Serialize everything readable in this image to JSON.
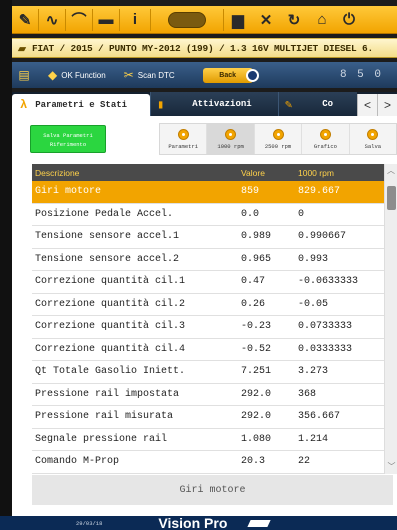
{
  "toolbar": {
    "icons": [
      "wrench-icon",
      "pulse-icon",
      "wifi-icon",
      "folder-icon",
      "info-icon",
      "brand-logo",
      "print-icon",
      "tools-icon",
      "refresh-icon",
      "home-icon",
      "power-icon"
    ],
    "info_label": "i"
  },
  "vehicle_path": "FIAT / 2015 / PUNTO MY-2012 (199) / 1.3 16V MULTIJET DIESEL 6.",
  "funcbar": {
    "ok_function": "OK Function",
    "scan_dtc": "Scan DTC",
    "back": "Back",
    "digits": "8 5 0"
  },
  "tabs": [
    {
      "label": "Parametri e Stati"
    },
    {
      "label": "Attivazioni"
    },
    {
      "label": "Co"
    }
  ],
  "nav": {
    "prev": "<",
    "next": ">"
  },
  "save_reference": "Salva Parametri Riferimento",
  "tools": [
    {
      "label": "Parametri"
    },
    {
      "label": "1000 rpm"
    },
    {
      "label": "2500 rpm"
    },
    {
      "label": "Grafico"
    },
    {
      "label": "Salva"
    }
  ],
  "table": {
    "headers": {
      "description": "Descrizione",
      "value": "Valore",
      "rpm": "1000 rpm"
    },
    "rows": [
      {
        "description": "Giri motore",
        "value": "859",
        "rpm": "829.667"
      },
      {
        "description": "Posizione Pedale Accel.",
        "value": "0.0",
        "rpm": "0"
      },
      {
        "description": "Tensione sensore accel.1",
        "value": "0.989",
        "rpm": "0.990667"
      },
      {
        "description": "Tensione sensore accel.2",
        "value": "0.965",
        "rpm": "0.993"
      },
      {
        "description": "Correzione quantità cil.1",
        "value": "0.47",
        "rpm": "-0.0633333"
      },
      {
        "description": "Correzione quantità cil.2",
        "value": "0.26",
        "rpm": "-0.05"
      },
      {
        "description": "Correzione quantità cil.3",
        "value": "-0.23",
        "rpm": "0.0733333"
      },
      {
        "description": "Correzione quantità cil.4",
        "value": "-0.52",
        "rpm": "0.0333333"
      },
      {
        "description": "Qt Totale Gasolio Iniett.",
        "value": "7.251",
        "rpm": "3.273"
      },
      {
        "description": "Pressione rail impostata",
        "value": "292.0",
        "rpm": "368"
      },
      {
        "description": "Pressione rail misurata",
        "value": "292.0",
        "rpm": "356.667"
      },
      {
        "description": "Segnale pressione rail",
        "value": "1.080",
        "rpm": "1.214"
      },
      {
        "description": "Comando M-Prop",
        "value": "20.3",
        "rpm": "22"
      }
    ]
  },
  "footer_label": "Giri motore",
  "bottom": {
    "date": "29/03/18",
    "brand": "Vision Pro"
  },
  "colors": {
    "accent": "#f2a400",
    "header": "#4a4a4a",
    "save_green": "#2bd640"
  }
}
